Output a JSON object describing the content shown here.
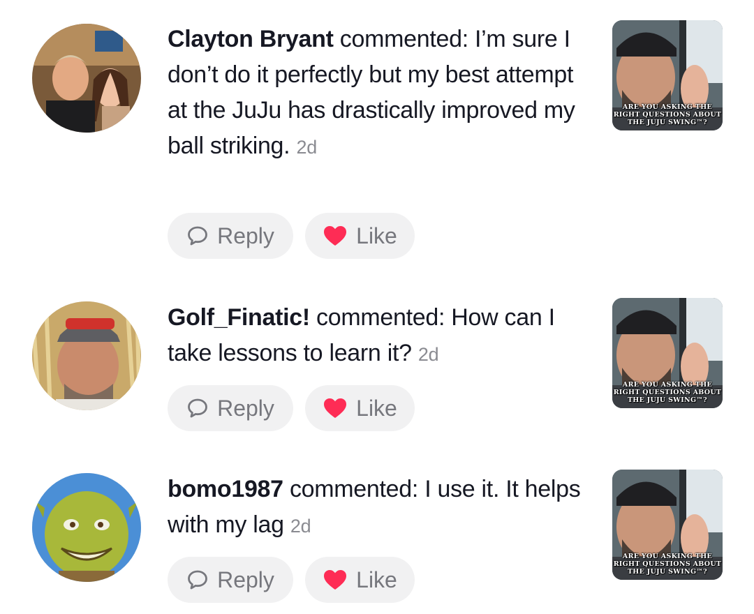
{
  "comments": [
    {
      "author": "Clayton Bryant",
      "verb": "commented:",
      "text": "I’m sure I don’t do it perfectly but my best attempt at the JuJu has drastically improved my ball striking.",
      "time": "2d",
      "reply_label": "Reply",
      "like_label": "Like",
      "video_caption": "ARE YOU ASKING THE RIGHT QUESTIONS ABOUT THE JUJU SWING™?"
    },
    {
      "author": "Golf_Finatic!",
      "verb": "commented:",
      "text": "How can I take lessons to learn it?",
      "time": "2d",
      "reply_label": "Reply",
      "like_label": "Like",
      "video_caption": "ARE YOU ASKING THE RIGHT QUESTIONS ABOUT THE JUJU SWING™?"
    },
    {
      "author": "bomo1987",
      "verb": "commented:",
      "text": "I use it. It helps with my lag",
      "time": "2d",
      "reply_label": "Reply",
      "like_label": "Like",
      "video_caption": "ARE YOU ASKING THE RIGHT QUESTIONS ABOUT THE JUJU SWING™?"
    }
  ],
  "icons": {
    "reply": "speech-bubble-icon",
    "like": "heart-icon"
  },
  "colors": {
    "like_heart": "#fe2c55",
    "pill_bg": "#f1f1f2",
    "muted_text": "#8a8b91"
  }
}
